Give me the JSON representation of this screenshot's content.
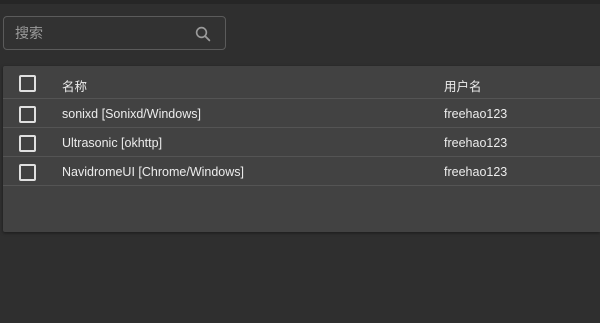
{
  "search": {
    "placeholder": "搜索",
    "icon": "search-icon"
  },
  "table": {
    "columns": {
      "name": "名称",
      "username": "用户名"
    },
    "rows": [
      {
        "name": "sonixd [Sonixd/Windows]",
        "username": "freehao123",
        "checked": false
      },
      {
        "name": "Ultrasonic [okhttp]",
        "username": "freehao123",
        "checked": false
      },
      {
        "name": "NavidromeUI [Chrome/Windows]",
        "username": "freehao123",
        "checked": false
      }
    ],
    "select_all_checked": false
  }
}
